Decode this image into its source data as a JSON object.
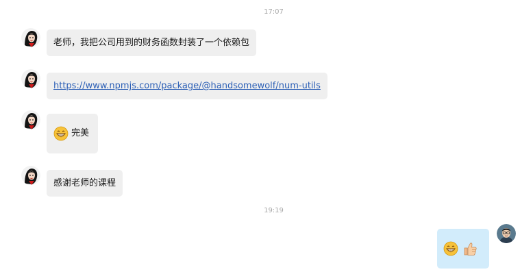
{
  "chat": {
    "timestamps": [
      "17:07",
      "19:19"
    ],
    "messages": [
      {
        "sender": "teacher",
        "text": "老师，我把公司用到的财务函数封装了一个依赖包"
      },
      {
        "sender": "teacher",
        "link": "https://www.npmjs.com/package/@handsomewolf/num-utils"
      },
      {
        "sender": "teacher",
        "emoji": "grinning-face-icon",
        "text": "完美"
      },
      {
        "sender": "teacher",
        "text": "感谢老师的课程"
      },
      {
        "sender": "me",
        "emojis": [
          "grinning-face-icon",
          "thumbs-up-icon"
        ]
      }
    ]
  }
}
